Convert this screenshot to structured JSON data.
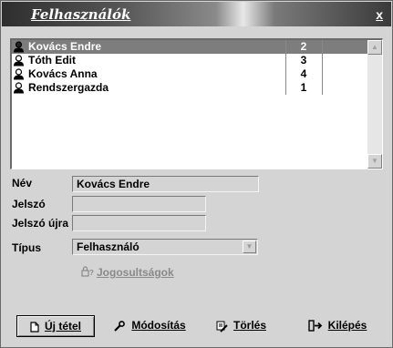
{
  "window": {
    "title": "Felhasználók",
    "close": "x"
  },
  "users": [
    {
      "name": "Kovács Endre",
      "id": "2",
      "selected": true
    },
    {
      "name": "Tóth Edit",
      "id": "3"
    },
    {
      "name": "Kovács Anna",
      "id": "4"
    },
    {
      "name": "Rendszergazda",
      "id": "1"
    }
  ],
  "form": {
    "name_label": "Név",
    "name_value": "Kovács Endre",
    "password_label": "Jelszó",
    "password_value": "",
    "password_again_label": "Jelszó újra",
    "password_again_value": "",
    "type_label": "Típus",
    "type_value": "Felhasználó",
    "permissions_label": "Jogosultságok"
  },
  "buttons": {
    "new": "Új tétel",
    "modify": "Módosítás",
    "delete": "Törlés",
    "exit": "Kilépés"
  },
  "icons": {
    "user": "user-icon",
    "permissions": "lock-icon",
    "new": "new-document-icon",
    "modify": "wrench-icon",
    "delete": "eraser-icon",
    "exit": "exit-door-icon"
  },
  "colors": {
    "selection": "#7d7d7d",
    "disabled_text": "#8a8a8a"
  }
}
